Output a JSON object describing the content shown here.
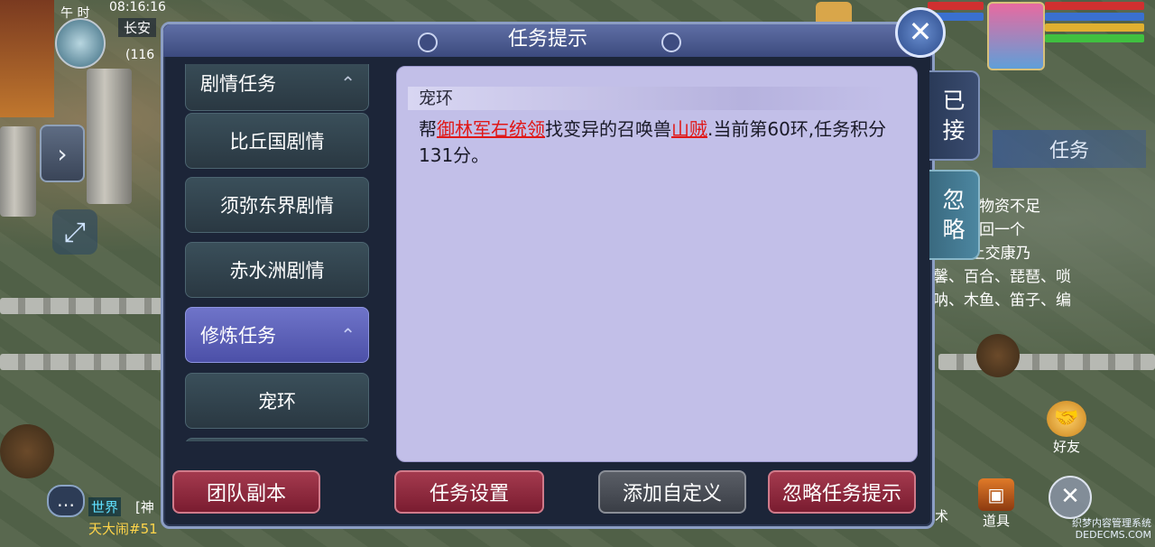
{
  "hud": {
    "time_label": "午 时",
    "clock": "08:16:16",
    "map_name": "长安",
    "coord": "(116",
    "chat_channel": "世界",
    "chat_channel2": "[神",
    "chat_line": "天大闹#51"
  },
  "dialog": {
    "title": "任务提示",
    "close_icon": "✕"
  },
  "left_list": [
    {
      "label": "剧情任务",
      "kind": "category"
    },
    {
      "label": "比丘国剧情",
      "kind": "item"
    },
    {
      "label": "须弥东界剧情",
      "kind": "item"
    },
    {
      "label": "赤水洲剧情",
      "kind": "item"
    },
    {
      "label": "修炼任务",
      "kind": "category",
      "active": true
    },
    {
      "label": "宠环",
      "kind": "item"
    }
  ],
  "side_tabs": [
    {
      "label_line1": "已",
      "label_line2": "接",
      "selected": true
    },
    {
      "label_line1": "忽",
      "label_line2": "略",
      "selected": false
    }
  ],
  "content": {
    "header": "宠环",
    "text_1": "帮",
    "npc": "御林军右统领",
    "text_2": "找变异的召唤兽",
    "target": "山贼",
    "text_3": ".当前第60环,任务积分131分。"
  },
  "buttons": {
    "team_dungeon": "团队副本",
    "quest_settings": "任务设置",
    "add_custom": "添加自定义",
    "ignore_hint": "忽略任务提示"
  },
  "quest_panel": {
    "tab": "任务",
    "title": "任务",
    "lines": [
      "门库存物资不足",
      "门派找回一个",
      "(也可上交康乃",
      "馨、百合、琵琶、唢",
      "呐、木鱼、笛子、编"
    ]
  },
  "side_hud": {
    "friend_label": "好友",
    "tool_label": "道具",
    "tool2_label": "术"
  },
  "watermark": {
    "line1": "织梦内容管理系统",
    "line2": "DEDECMS.COM"
  },
  "colors": {
    "dialog_bg": "#1c2538",
    "content_bg": "#c2bfe8",
    "accent_red": "#e01818",
    "active_tab": "#5c62b8"
  }
}
